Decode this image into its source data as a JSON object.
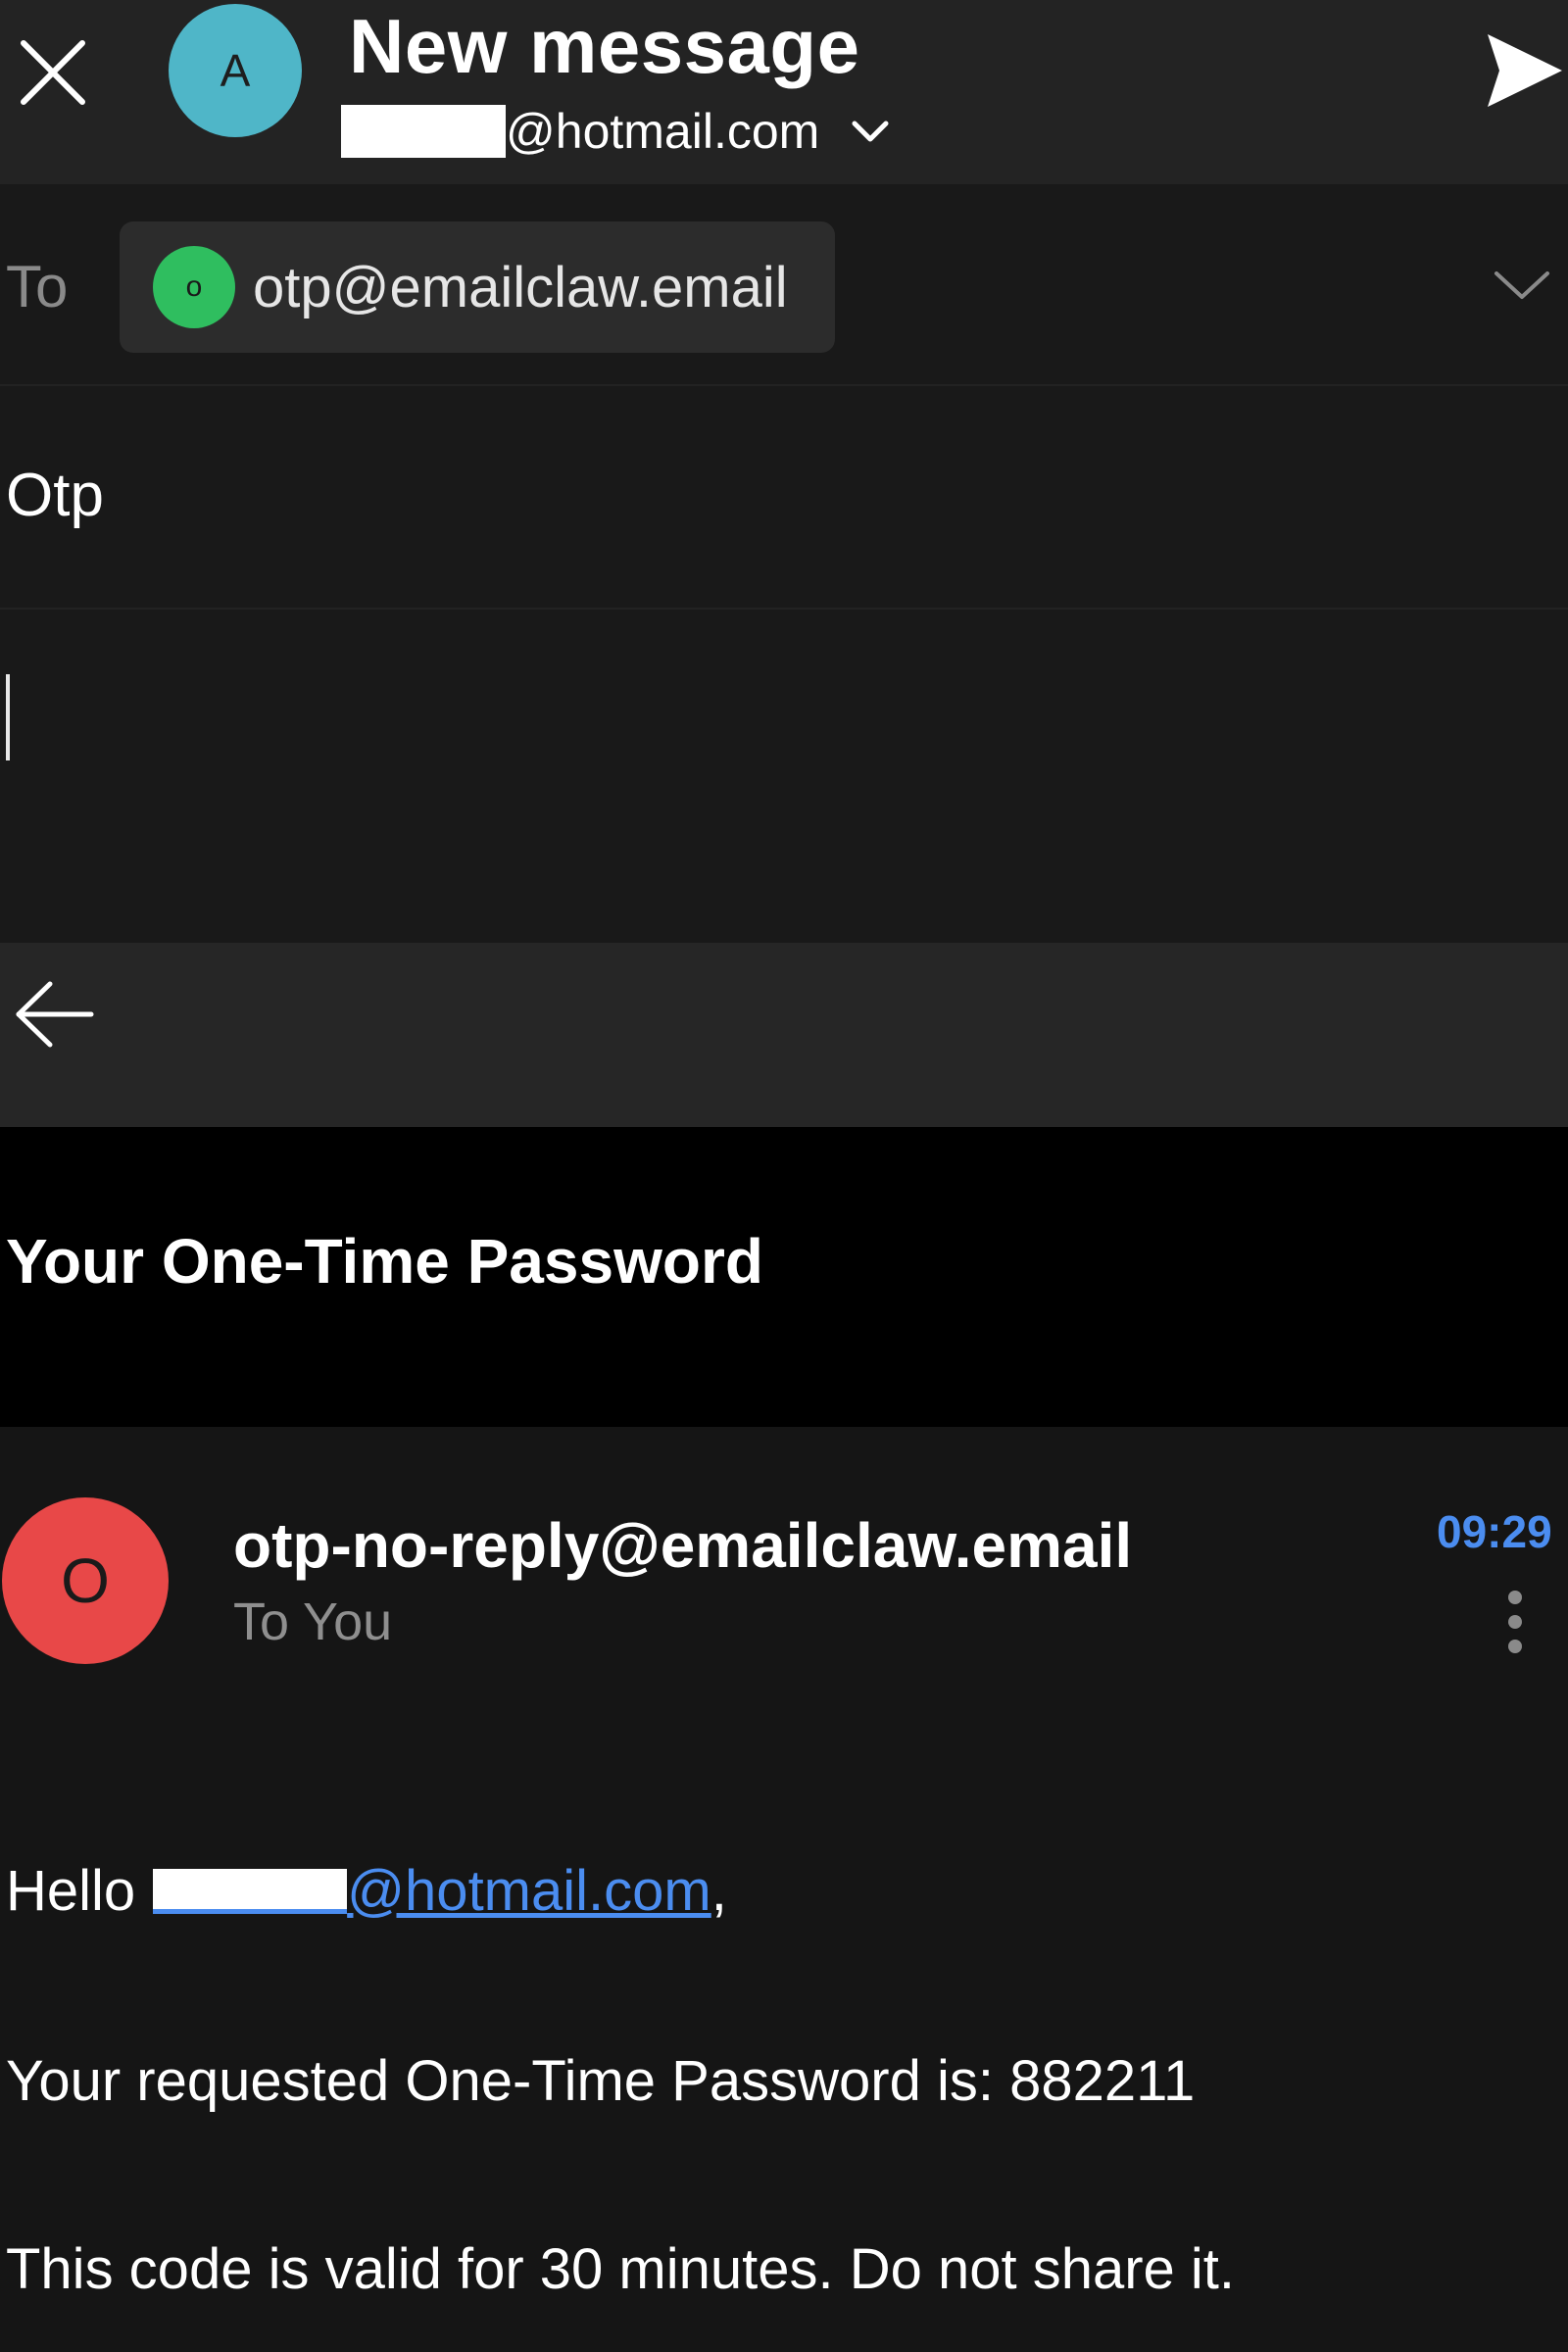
{
  "header": {
    "title": "New message",
    "account_initial": "A",
    "from_domain": "@hotmail.com",
    "colors": {
      "avatar": "#4fb6c8",
      "background": "#232323"
    },
    "icons": {
      "close": "close-icon",
      "send": "send-icon",
      "from_toggle": "chevron-down-icon"
    }
  },
  "to_field": {
    "label": "To",
    "recipient": {
      "initial": "o",
      "email": "otp@emailclaw.email",
      "avatar_color": "#2fbe5f"
    },
    "expand_icon": "chevron-down-icon"
  },
  "subject": {
    "value": "Otp"
  },
  "body": {
    "value": ""
  },
  "quoted": {
    "back_icon": "arrow-left-icon",
    "subject": "Your One-Time Password",
    "sender": {
      "initial": "O",
      "email": "otp-no-reply@emailclaw.email",
      "to_line": "To You",
      "avatar_color": "#e84848"
    },
    "time": "09:29",
    "time_color": "#4b8df0",
    "more_icon": "more-vertical-icon",
    "greeting_prefix": "Hello",
    "greeting_link": "@hotmail.com",
    "greeting_suffix": ",",
    "link_color": "#4b8df0",
    "paragraphs": [
      "Your requested One-Time Password is: 882211",
      "This code is valid for 30 minutes. Do not share it."
    ]
  }
}
